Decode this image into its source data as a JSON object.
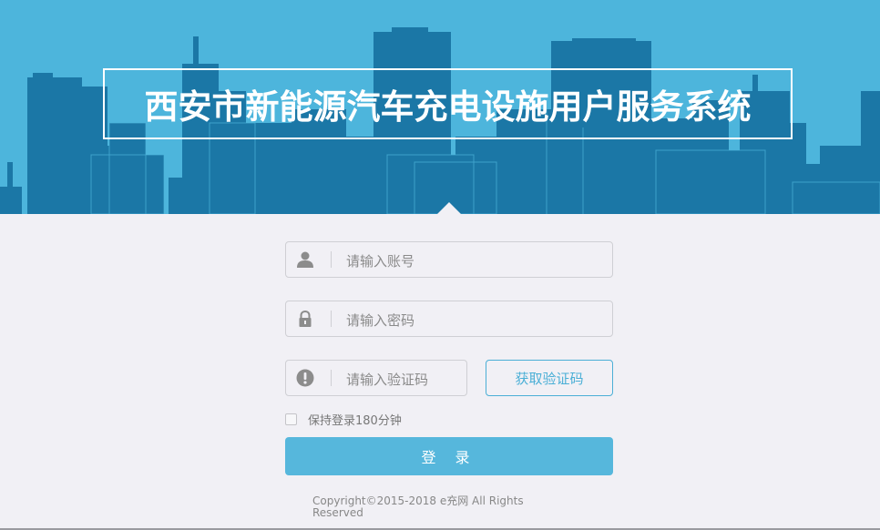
{
  "header": {
    "title": "西安市新能源汽车充电设施用户服务系统"
  },
  "form": {
    "account_placeholder": "请输入账号",
    "password_placeholder": "请输入密码",
    "code_placeholder": "请输入验证码",
    "get_code_label": "获取验证码",
    "remember_label": "保持登录180分钟",
    "login_label": "登 录"
  },
  "footer": {
    "copyright": "Copyright©2015-2018 e充网 All Rights Reserved"
  },
  "colors": {
    "banner_bg": "#4db5dc",
    "buildings": "#1f7fae",
    "accent": "#4bafd6",
    "page_bg": "#f1f0f5"
  },
  "icons": {
    "account": "user-icon",
    "password": "lock-icon",
    "code": "exclamation-icon"
  }
}
